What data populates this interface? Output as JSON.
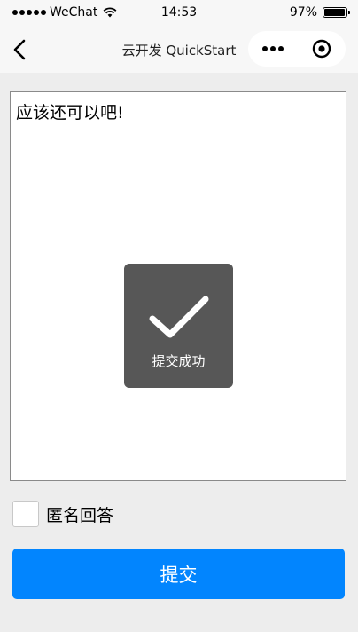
{
  "status_bar": {
    "carrier": "WeChat",
    "time": "14:53",
    "battery_percent_label": "97%",
    "battery_level": 0.97
  },
  "nav": {
    "title": "云开发 QuickStart"
  },
  "answer": {
    "text": "应该还可以吧!"
  },
  "toast": {
    "message": "提交成功"
  },
  "anonymous": {
    "label": "匿名回答",
    "checked": false
  },
  "submit": {
    "label": "提交",
    "color": "#0285fe"
  }
}
